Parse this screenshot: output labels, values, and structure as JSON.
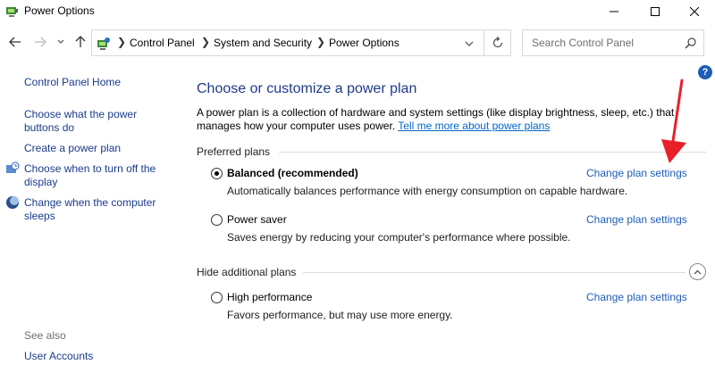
{
  "window": {
    "title": "Power Options"
  },
  "address_bar": {
    "crumbs": [
      "Control Panel",
      "System and Security",
      "Power Options"
    ],
    "search_placeholder": "Search Control Panel"
  },
  "left_pane": {
    "links": [
      "Control Panel Home",
      "Choose what the power buttons do",
      "Create a power plan",
      "Choose when to turn off the display",
      "Change when the computer sleeps"
    ],
    "see_also_label": "See also",
    "see_also_links": [
      "User Accounts"
    ]
  },
  "main": {
    "heading": "Choose or customize a power plan",
    "description": "A power plan is a collection of hardware and system settings (like display brightness, sleep, etc.) that manages how your computer uses power.",
    "learn_more": "Tell me more about power plans",
    "preferred_label": "Preferred plans",
    "hidden_label": "Hide additional plans",
    "plans": [
      {
        "name": "Balanced (recommended)",
        "desc": "Automatically balances performance with energy consumption on capable hardware.",
        "selected": true,
        "action": "Change plan settings"
      },
      {
        "name": "Power saver",
        "desc": "Saves energy by reducing your computer's performance where possible.",
        "selected": false,
        "action": "Change plan settings"
      },
      {
        "name": "High performance",
        "desc": "Favors performance, but may use more energy.",
        "selected": false,
        "action": "Change plan settings"
      }
    ]
  },
  "colors": {
    "link": "#1a3a8c",
    "accent": "#1e5db6",
    "annotation": "#e8202a"
  }
}
